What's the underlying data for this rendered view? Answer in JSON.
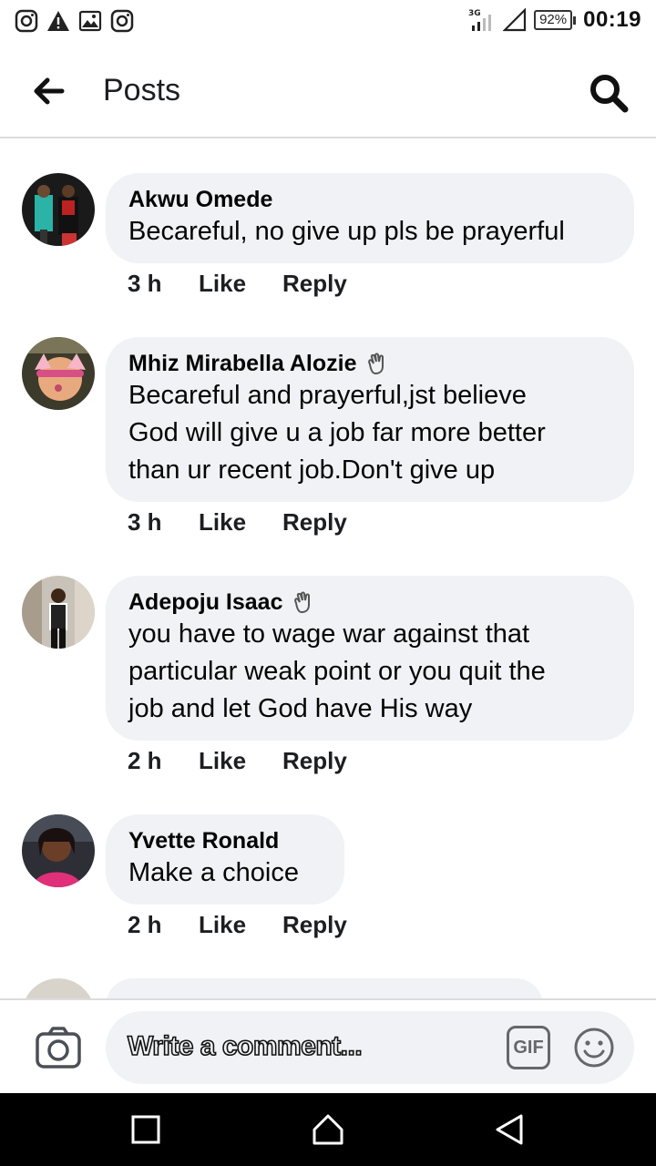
{
  "status_bar": {
    "network": "3G",
    "battery": "92%",
    "time": "00:19"
  },
  "header": {
    "title": "Posts"
  },
  "comments": [
    {
      "author": "Akwu Omede",
      "text": "Becareful, no give up pls be prayerful",
      "time": "3 h",
      "like_label": "Like",
      "reply_label": "Reply",
      "badge": false
    },
    {
      "author": "Mhiz Mirabella Alozie",
      "text": "Becareful and prayerful,jst believe\nGod will give u a job far more better\nthan ur recent job.Don't give up",
      "time": "3 h",
      "like_label": "Like",
      "reply_label": "Reply",
      "badge": true
    },
    {
      "author": "Adepoju Isaac",
      "text": "you have to wage war against that\nparticular weak point or you quit the\njob and let God have His way",
      "time": "2 h",
      "like_label": "Like",
      "reply_label": "Reply",
      "badge": true
    },
    {
      "author": "Yvette Ronald",
      "text": "Make a choice",
      "time": "2 h",
      "like_label": "Like",
      "reply_label": "Reply",
      "badge": false
    }
  ],
  "composer": {
    "placeholder": "Write a comment...",
    "gif_label": "GIF"
  },
  "icons": {
    "back": "arrow-left-icon",
    "search": "search-icon",
    "camera": "camera-icon",
    "emoji": "smiley-icon",
    "badge": "waving-hand-icon"
  }
}
